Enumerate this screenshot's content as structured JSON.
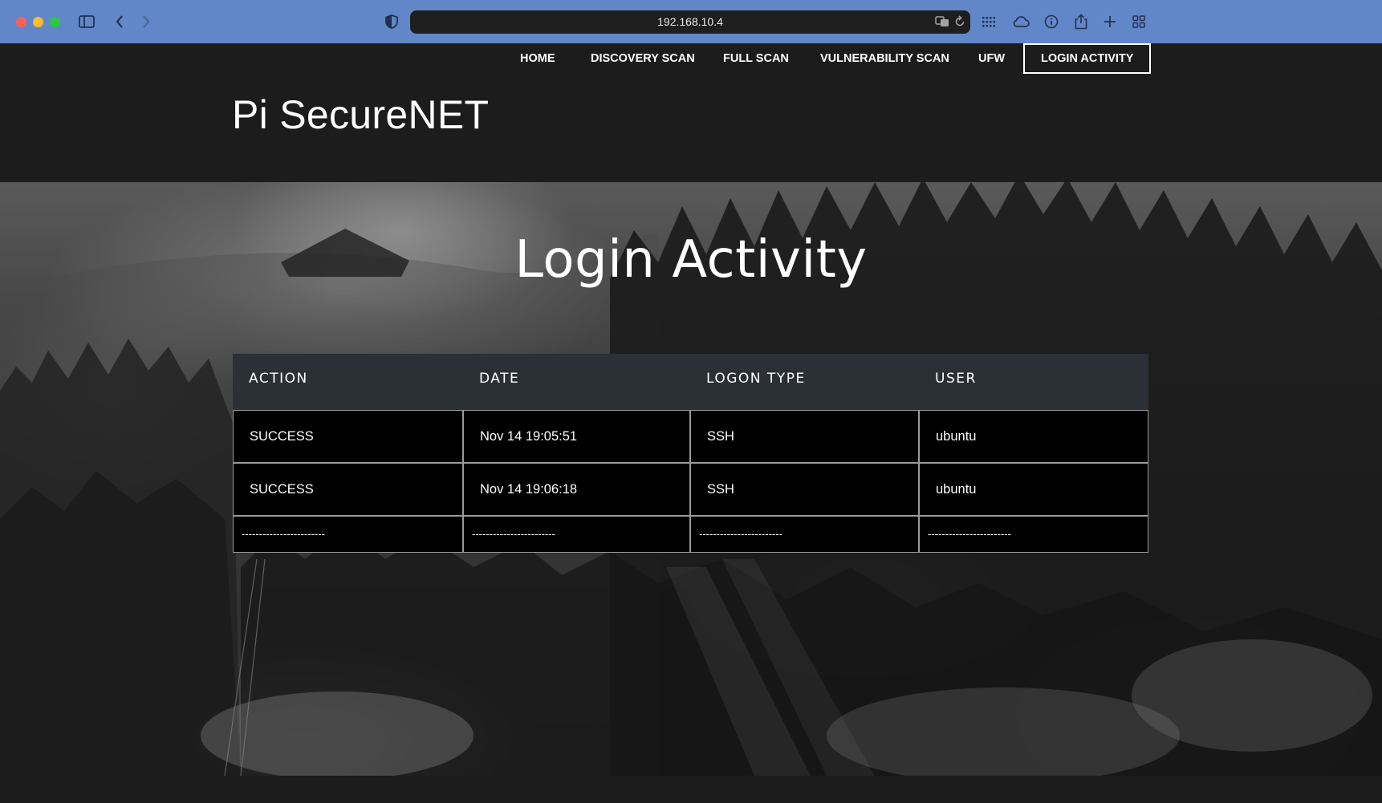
{
  "browser": {
    "url": "192.168.10.4",
    "traffic_lights": [
      "#ff5f57",
      "#febc2e",
      "#28c840"
    ]
  },
  "site": {
    "logo": "Pi SecureNET",
    "nav": [
      {
        "label": "HOME",
        "active": false
      },
      {
        "label": "DISCOVERY SCAN",
        "active": false
      },
      {
        "label": "FULL SCAN",
        "active": false
      },
      {
        "label": "VULNERABILITY SCAN",
        "active": false
      },
      {
        "label": "UFW",
        "active": false
      },
      {
        "label": "LOGIN ACTIVITY",
        "active": true
      }
    ]
  },
  "main": {
    "title": "Login Activity",
    "table": {
      "headers": [
        "ACTION",
        "DATE",
        "LOGON TYPE",
        "USER"
      ],
      "rows": [
        [
          "SUCCESS",
          "Nov 14 19:05:51",
          "SSH",
          "ubuntu"
        ],
        [
          "SUCCESS",
          "Nov 14 19:06:18",
          "SSH",
          "ubuntu"
        ],
        [
          "------------------------",
          "------------------------",
          "------------------------",
          "------------------------"
        ]
      ]
    }
  },
  "colors": {
    "chrome": "#6287c8",
    "header_bg": "#1c1c1d",
    "table_head_bg": "#2b2f36",
    "row_bg": "#000000"
  }
}
